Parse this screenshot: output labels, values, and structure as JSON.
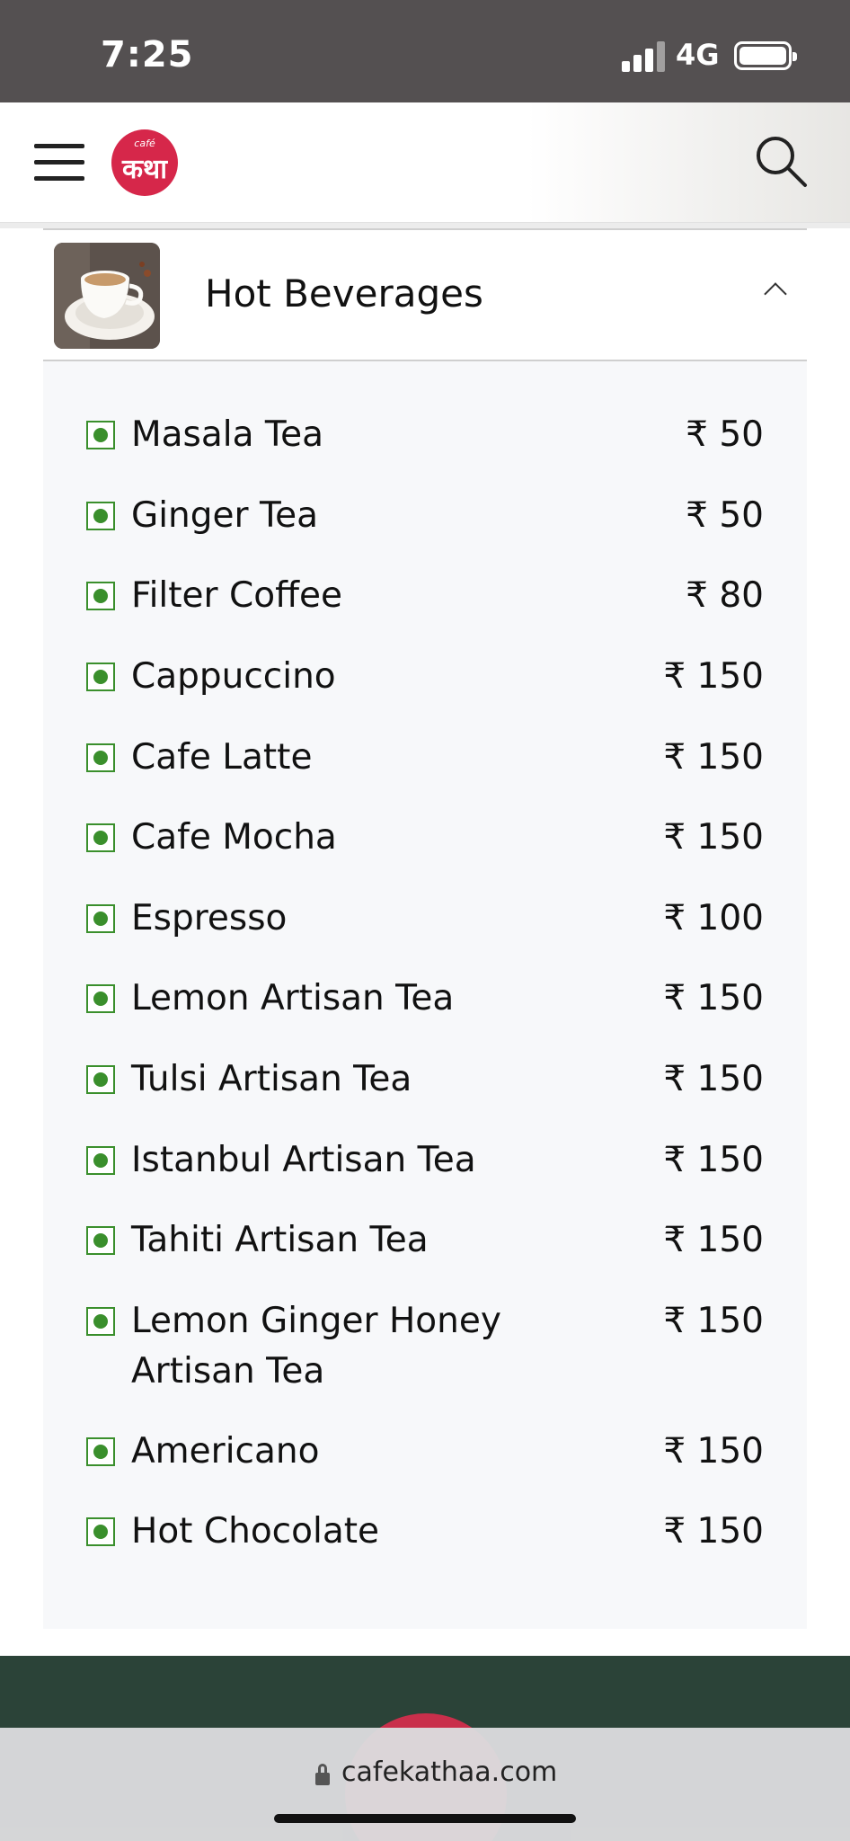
{
  "status_bar": {
    "time": "7:25",
    "network": "4G"
  },
  "header": {
    "logo_small": "café",
    "logo_text": "कथा"
  },
  "category": {
    "title": "Hot Beverages"
  },
  "menu_items": [
    {
      "name": "Masala Tea",
      "price": "₹ 50"
    },
    {
      "name": "Ginger Tea",
      "price": "₹ 50"
    },
    {
      "name": "Filter Coffee",
      "price": "₹ 80"
    },
    {
      "name": "Cappuccino",
      "price": "₹ 150"
    },
    {
      "name": "Cafe Latte",
      "price": "₹ 150"
    },
    {
      "name": "Cafe Mocha",
      "price": "₹ 150"
    },
    {
      "name": "Espresso",
      "price": "₹ 100"
    },
    {
      "name": "Lemon Artisan Tea",
      "price": "₹ 150"
    },
    {
      "name": "Tulsi Artisan Tea",
      "price": "₹ 150"
    },
    {
      "name": "Istanbul Artisan Tea",
      "price": "₹ 150"
    },
    {
      "name": "Tahiti Artisan Tea",
      "price": "₹ 150"
    },
    {
      "name": "Lemon Ginger Honey Artisan Tea",
      "price": "₹ 150"
    },
    {
      "name": "Americano",
      "price": "₹ 150"
    },
    {
      "name": "Hot Chocolate",
      "price": "₹ 150"
    }
  ],
  "browser": {
    "url": "cafekathaa.com"
  },
  "colors": {
    "brand_red": "#d6274a",
    "veg_green": "#3a8f2c",
    "footer_green": "#2b4338"
  }
}
